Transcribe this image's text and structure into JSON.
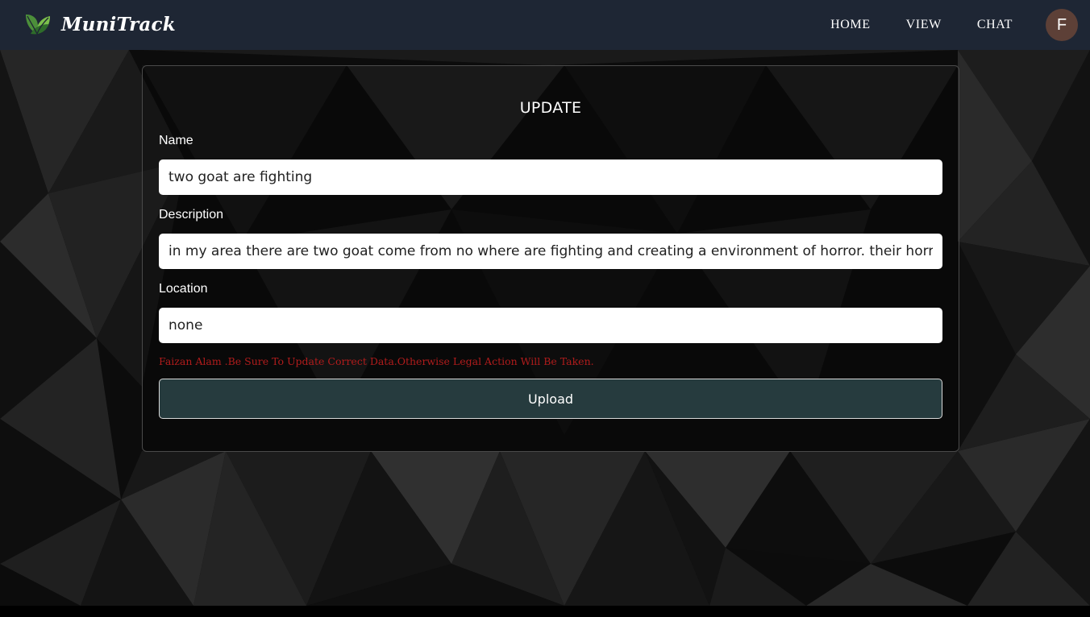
{
  "navbar": {
    "brand": "MuniTrack",
    "links": [
      "HOME",
      "VIEW",
      "CHAT"
    ],
    "avatar_initial": "F",
    "logo_icon": "leaf-logo-icon"
  },
  "form": {
    "title": "UPDATE",
    "name_label": "Name",
    "name_value": "two goat are fighting",
    "description_label": "Description",
    "description_value": "in my area there are two goat come from no where are fighting and creating a environment of horror. their horn a",
    "location_label": "Location",
    "location_value": "none",
    "warning": "Faizan Alam .Be Sure To Update Correct Data.Otherwise Legal Action Will Be Taken.",
    "upload_label": "Upload"
  },
  "colors": {
    "navbar_bg": "#1e2634",
    "button_bg": "#263b3e",
    "warning_text": "#b11c1c",
    "avatar_bg": "#5d4037"
  }
}
